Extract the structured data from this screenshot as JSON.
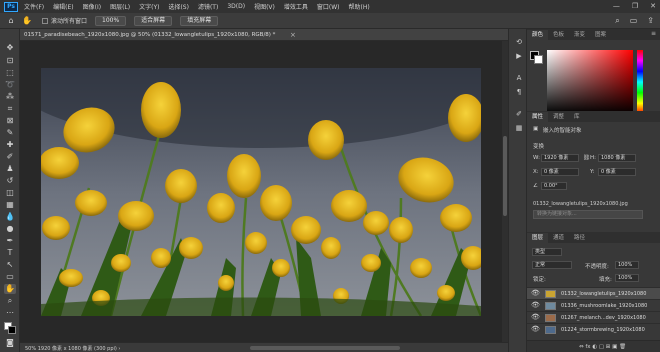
{
  "app": {
    "logo": "Ps"
  },
  "menu": [
    "文件(F)",
    "编辑(E)",
    "图像(I)",
    "图层(L)",
    "文字(Y)",
    "选择(S)",
    "滤镜(T)",
    "3D(D)",
    "视图(V)",
    "增效工具",
    "窗口(W)",
    "帮助(H)"
  ],
  "window_controls": {
    "minimize": "—",
    "maximize": "❐",
    "close": "✕"
  },
  "options": {
    "home_icon": "⌂",
    "hand_icon": "✋",
    "scroll_all_label": "滚动所有窗口",
    "zoom_value": "100%",
    "fit_screen_label": "适合屏幕",
    "fill_screen_label": "填充屏幕",
    "search_icon": "⌕",
    "workspace_icon": "▭",
    "share_icon": "⇪"
  },
  "document": {
    "tab_title": "01571_paradisebeach_1920x1080.jpg @ 50% (01332_lowangletulips_1920x1080, RGB/8) *",
    "tab_close": "×"
  },
  "status": {
    "text": "50%   1920 像素 x 1080 像素 (300 ppi)   ›"
  },
  "tools": [
    "move",
    "artboard",
    "marquee",
    "lasso",
    "magic-wand",
    "crop",
    "frame",
    "eyedropper",
    "healing",
    "brush",
    "clone-stamp",
    "history-brush",
    "eraser",
    "gradient",
    "blur",
    "dodge",
    "pen",
    "type",
    "path-select",
    "rectangle",
    "hand",
    "zoom",
    "more"
  ],
  "color_panel": {
    "tabs": [
      "颜色",
      "色板",
      "渐变",
      "图案"
    ],
    "menu": "≡"
  },
  "properties_panel": {
    "tabs": [
      "属性",
      "调整",
      "库"
    ],
    "layer_type": "嵌入的智能对象",
    "section": "变换",
    "w_label": "W:",
    "w_value": "1920 像素",
    "h_label": "H:",
    "h_value": "1080 像素",
    "x_label": "X:",
    "x_value": "0 像素",
    "y_label": "Y:",
    "y_value": "0 像素",
    "angle_label": "∠",
    "angle_value": "0.00°",
    "source_file": "01332_lowangletulips_1920x1080.jpg",
    "hint": "转换为链接对象..."
  },
  "layers_panel": {
    "tabs": [
      "图层",
      "通道",
      "路径"
    ],
    "filter_label": "类型",
    "blend_mode": "正常",
    "opacity_label": "不透明度:",
    "opacity_value": "100%",
    "lock_label": "锁定:",
    "fill_label": "填充:",
    "fill_value": "100%",
    "layers": [
      {
        "name": "01332_lowangletulips_1920x1080",
        "thumb": "#c9a432",
        "selected": true
      },
      {
        "name": "01336_mushroomlake_1920x1080",
        "thumb": "#6f8a9e",
        "selected": false
      },
      {
        "name": "01267_melanch...dev_1920x1080",
        "thumb": "#9b6b4a",
        "selected": false
      },
      {
        "name": "01224_stormbrewing_1920x1080",
        "thumb": "#4e6a8c",
        "selected": false
      }
    ],
    "footer_icons": "⇔  fx  ◐  ▢  ⊞  ▣  🗑"
  }
}
